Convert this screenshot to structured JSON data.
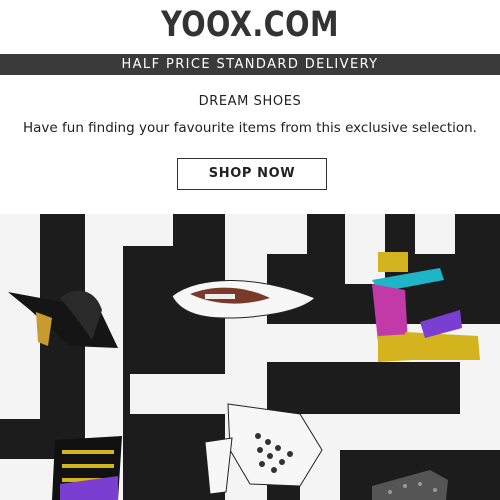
{
  "brand": {
    "logo_text": "YOOX.COM"
  },
  "promo": {
    "text": "HALF PRICE STANDARD DELIVERY"
  },
  "intro": {
    "headline": "DREAM SHOES",
    "subline": "Have fun finding your favourite items from this exclusive selection."
  },
  "cta": {
    "label": "SHOP NOW"
  },
  "hero": {
    "description_icons": [
      "black-mule-shoe-icon",
      "white-pointed-flat-icon",
      "metallic-platform-sandal-icon",
      "white-cutout-heel-icon",
      "caged-sandal-icon",
      "glitter-shoe-icon"
    ]
  },
  "colors": {
    "promo_bar": "#3a3a3a",
    "hero_black": "#1c1c1c",
    "hero_white": "#f4f4f4",
    "accent_gold": "#d4b41e",
    "accent_teal": "#1fb5c9",
    "accent_purple": "#7a3fd1",
    "accent_magenta": "#c23aa8"
  }
}
